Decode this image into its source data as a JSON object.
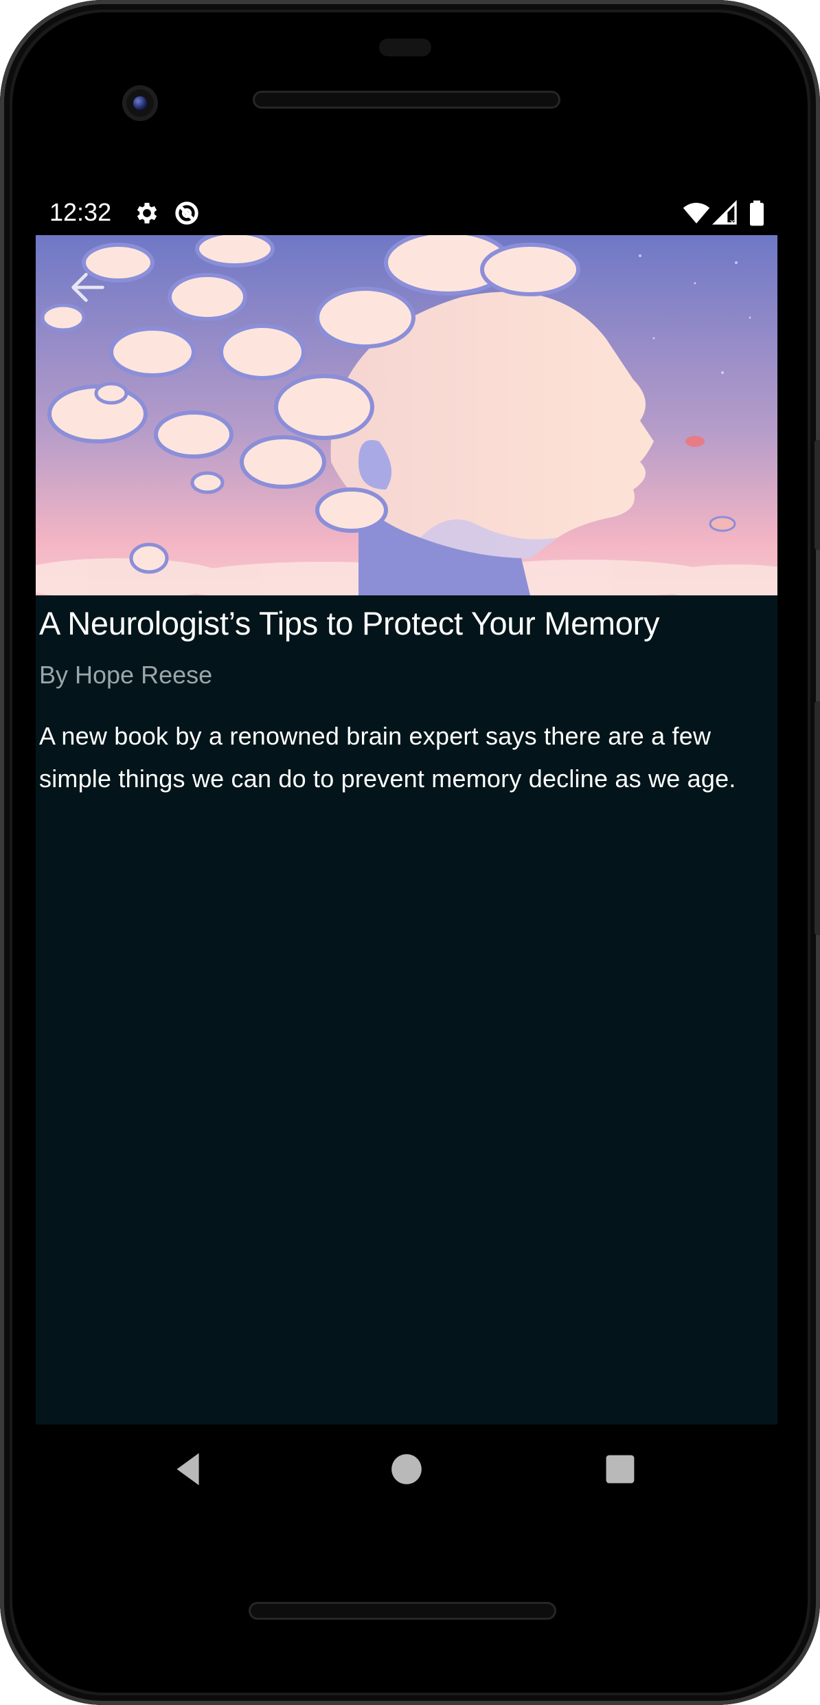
{
  "status_bar": {
    "time": "12:32",
    "icons": [
      "gear-icon",
      "no-sync-icon",
      "wifi-icon",
      "signal-icon",
      "battery-icon"
    ]
  },
  "article": {
    "title": "A Neurologist’s Tips to Protect Your Memory",
    "author": "By Hope Reese",
    "summary": "A new book by a renowned brain expert says there are a few simple things we can do to prevent memory decline as we age."
  },
  "hero_image": {
    "description_icon": "head-with-clouds-illustration"
  },
  "navigation": {
    "back": "back-arrow-icon",
    "system": [
      "back-triangle-icon",
      "home-circle-icon",
      "recents-square-icon"
    ]
  },
  "colors": {
    "screen_background": "#03151a",
    "author_text": "#9aa6aa",
    "title_text": "#ffffff"
  }
}
